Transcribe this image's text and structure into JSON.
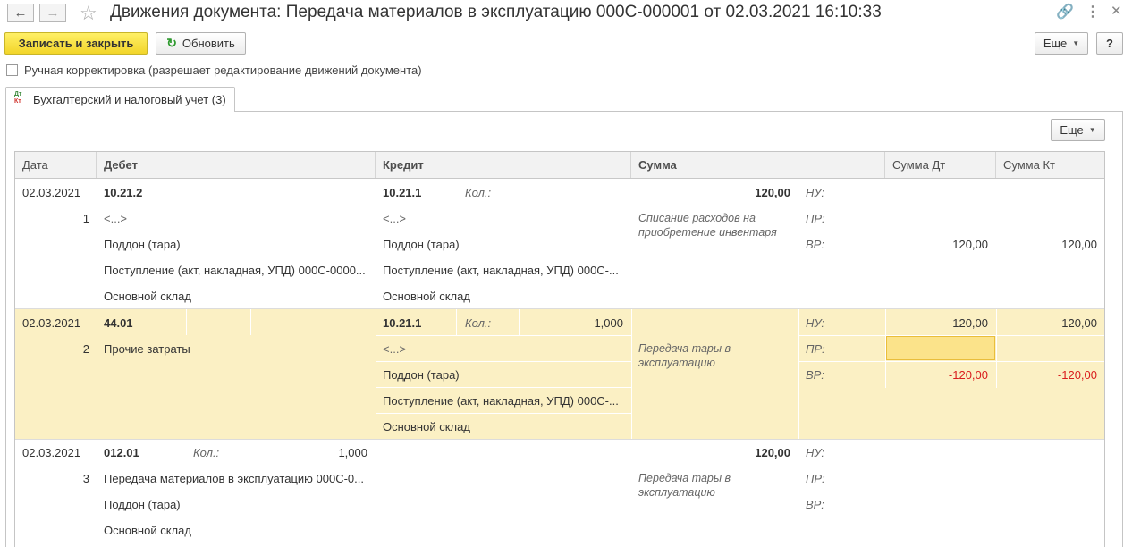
{
  "window": {
    "title": "Движения документа: Передача материалов в эксплуатацию 000С-000001 от 02.03.2021 16:10:33"
  },
  "toolbar": {
    "save_close": "Записать и закрыть",
    "refresh": "Обновить",
    "more": "Еще",
    "help": "?"
  },
  "manual_correction": {
    "label": "Ручная корректировка (разрешает редактирование движений документа)",
    "checked": false
  },
  "tab": {
    "icon_top": "Дт",
    "icon_bottom": "Кт",
    "label": "Бухгалтерский и налоговый учет (3)"
  },
  "table": {
    "more": "Еще",
    "headers": {
      "date": "Дата",
      "debit": "Дебет",
      "credit": "Кредит",
      "sum": "Сумма",
      "blank": "",
      "sum_dt": "Сумма Дт",
      "sum_kt": "Сумма Кт"
    },
    "rows": [
      {
        "date": "02.03.2021",
        "num": "1",
        "debit_account": "10.21.2",
        "debit_qty_label": "",
        "debit_qty": "",
        "debit_sub": [
          "<...>",
          "Поддон (тара)",
          "Поступление (акт, накладная, УПД) 000С-0000...",
          "Основной склад"
        ],
        "credit_account": "10.21.1",
        "credit_qty_label": "Кол.:",
        "credit_qty": "",
        "credit_sub": [
          "<...>",
          "Поддон (тара)",
          "Поступление (акт, накладная, УПД) 000С-...",
          "Основной склад"
        ],
        "sum": "120,00",
        "content": "Списание расходов на приобретение инвентаря",
        "nu_label": "НУ:",
        "pr_label": "ПР:",
        "vr_label": "ВР:",
        "nu_dt": "",
        "nu_kt": "",
        "pr_dt": "",
        "pr_kt": "",
        "vr_dt": "120,00",
        "vr_kt": "120,00"
      },
      {
        "date": "02.03.2021",
        "num": "2",
        "debit_account": "44.01",
        "debit_sub": [
          "Прочие затраты"
        ],
        "credit_account": "10.21.1",
        "credit_qty_label": "Кол.:",
        "credit_qty": "1,000",
        "credit_sub": [
          "<...>",
          "Поддон (тара)",
          "Поступление (акт, накладная, УПД) 000С-...",
          "Основной склад"
        ],
        "sum": "",
        "content": "Передача тары в эксплуатацию",
        "nu_label": "НУ:",
        "pr_label": "ПР:",
        "vr_label": "ВР:",
        "nu_dt": "120,00",
        "nu_kt": "120,00",
        "pr_dt": "",
        "pr_kt": "",
        "vr_dt": "-120,00",
        "vr_kt": "-120,00"
      },
      {
        "date": "02.03.2021",
        "num": "3",
        "debit_account": "012.01",
        "debit_qty_label": "Кол.:",
        "debit_qty": "1,000",
        "debit_sub": [
          "Передача материалов в эксплуатацию 000С-0...",
          "Поддон (тара)",
          "Основной склад"
        ],
        "credit_account": "",
        "sum": "120,00",
        "content": "Передача тары в эксплуатацию",
        "nu_label": "НУ:",
        "pr_label": "ПР:",
        "vr_label": "ВР:"
      }
    ]
  },
  "colors": {
    "primary_button": "#f2d52a",
    "selected_row": "#fbf0c4",
    "negative": "#d91d1d"
  }
}
